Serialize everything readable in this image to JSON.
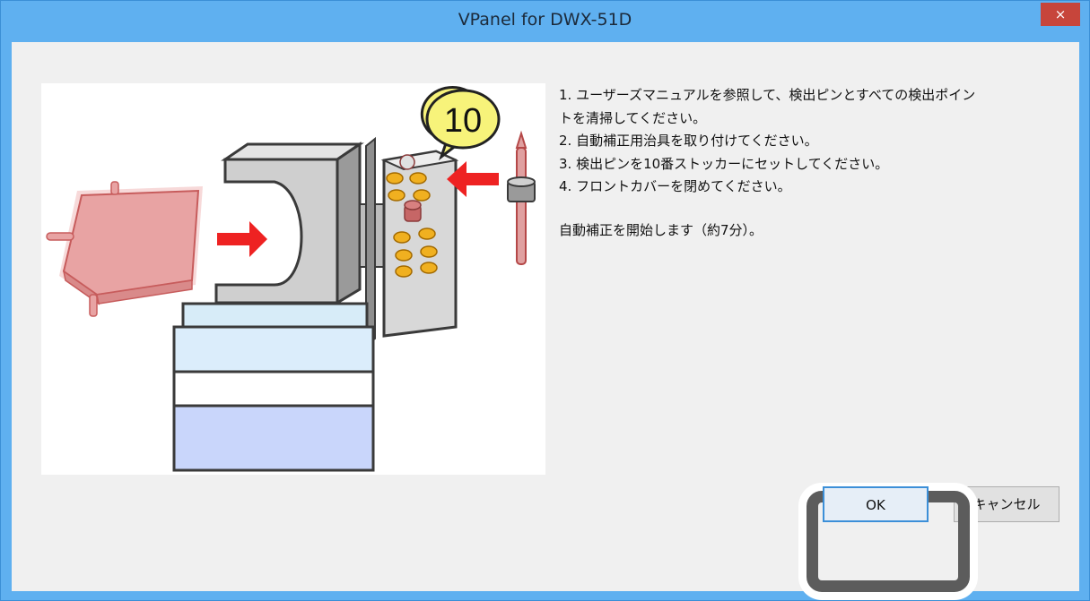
{
  "window": {
    "title": "VPanel for DWX-51D",
    "close_label": "×"
  },
  "illustration": {
    "stocker_number": "10"
  },
  "instructions": {
    "line1": "1. ユーザーズマニュアルを参照して、検出ピンとすべての検出ポイン",
    "line1b": "トを清掃してください。",
    "line2": "2. 自動補正用治具を取り付けてください。",
    "line3": "3. 検出ピンを10番ストッカーにセットしてください。",
    "line4": "4. フロントカバーを閉めてください。",
    "start_message": "自動補正を開始します（約7分）。"
  },
  "buttons": {
    "ok": "OK",
    "cancel": "キャンセル"
  },
  "colors": {
    "title_bar": "#5fb0f0",
    "close_button": "#c7453b",
    "client_bg": "#f0f0f0",
    "arrow": "#ee2222",
    "jig": "#e8a3a3",
    "coin": "#f0b020",
    "callout": "#f7f37a",
    "highlight_frame": "#5c5c5c"
  }
}
